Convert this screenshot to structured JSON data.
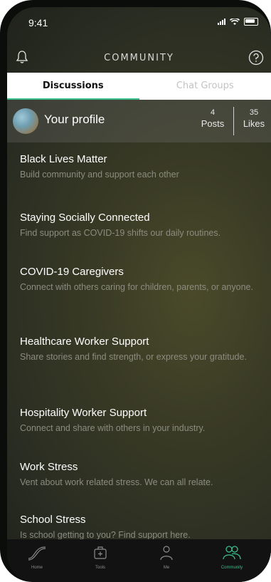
{
  "status": {
    "time": "9:41"
  },
  "header": {
    "title": "COMMUNITY",
    "left_icon": "bell-icon",
    "right_icon": "help-icon"
  },
  "tabs": [
    {
      "label": "Discussions",
      "active": true
    },
    {
      "label": "Chat Groups",
      "active": false
    }
  ],
  "profile": {
    "label": "Your profile",
    "posts_count": "4",
    "posts_label": "Posts",
    "likes_count": "35",
    "likes_label": "Likes"
  },
  "discussions": [
    {
      "title": "Black Lives Matter",
      "description": "Build community and support each other"
    },
    {
      "title": "Staying Socially Connected",
      "description": "Find support as COVID-19 shifts our daily routines."
    },
    {
      "title": "COVID-19 Caregivers",
      "description": "Connect with others caring for children, parents, or anyone."
    },
    {
      "title": "Healthcare Worker Support",
      "description": "Share stories and find strength, or express your gratitude."
    },
    {
      "title": "Hospitality Worker Support",
      "description": "Connect and share with others in your industry."
    },
    {
      "title": "Work Stress",
      "description": "Vent about work related stress. We can all relate."
    },
    {
      "title": "School Stress",
      "description": "Is school getting to you? Find support here."
    }
  ],
  "tabbar": [
    {
      "label": "Home",
      "icon": "home-icon",
      "active": false
    },
    {
      "label": "Tools",
      "icon": "tools-icon",
      "active": false
    },
    {
      "label": "Me",
      "icon": "me-icon",
      "active": false
    },
    {
      "label": "Community",
      "icon": "community-icon",
      "active": true
    }
  ],
  "colors": {
    "accent": "#3bbf8c",
    "tabbar": "#121212",
    "description": "#8c8c80"
  }
}
